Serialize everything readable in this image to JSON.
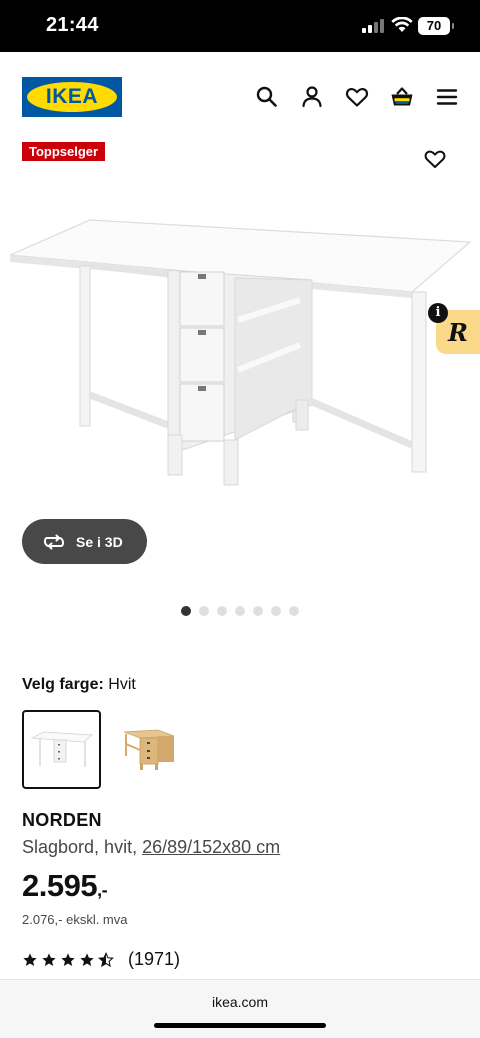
{
  "status_bar": {
    "time": "21:44",
    "battery": "70"
  },
  "header": {
    "logo_text": "IKEA",
    "brand_colors": {
      "blue": "#0058a3",
      "yellow": "#ffdb00"
    },
    "icons": [
      "search-icon",
      "account-icon",
      "heart-icon",
      "basket-icon",
      "menu-icon"
    ]
  },
  "product": {
    "badge": "Toppselger",
    "badge_color": "#cc0008",
    "view_3d_label": "Se i 3D",
    "carousel": {
      "total": 7,
      "active_index": 0
    },
    "color_label": "Velg farge:",
    "color_value": "Hvit",
    "swatches": [
      {
        "name": "Hvit",
        "selected": true
      },
      {
        "name": "Bjørk",
        "selected": false
      }
    ],
    "name": "NORDEN",
    "description": "Slagbord, hvit, ",
    "measurements": "26/89/152x80 cm",
    "price": "2.595",
    "price_suffix": ",-",
    "price_ex_vat": "2.076,- ekskl. mva",
    "rating": 4.5,
    "review_count": "(1971)"
  },
  "browser": {
    "domain": "ikea.com"
  }
}
